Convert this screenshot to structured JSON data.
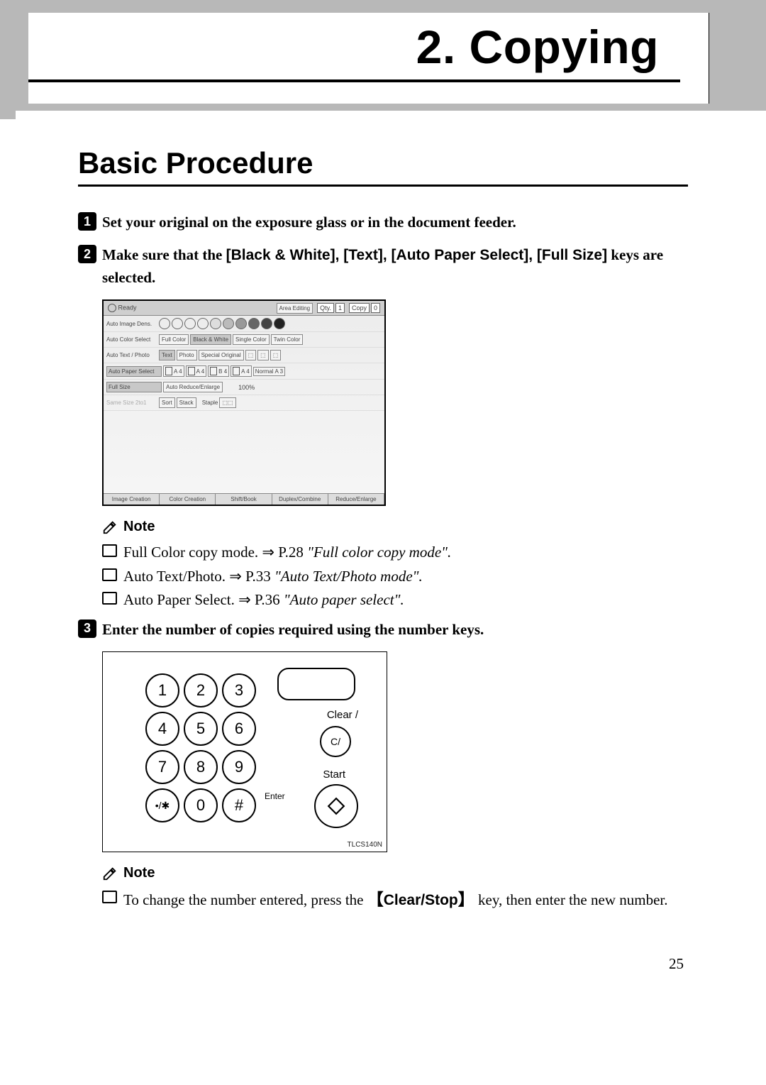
{
  "chapter": {
    "number": "2.",
    "title": "Copying"
  },
  "section": {
    "title": "Basic Procedure"
  },
  "steps": {
    "s1": {
      "num": "1",
      "text": "Set your original on the exposure glass or in the document feeder."
    },
    "s2": {
      "num": "2",
      "prefix": "Make sure that the ",
      "keys": "[Black & White], [Text], [Auto Paper Select], [Full Size]",
      "suffix": " keys are selected."
    },
    "s3": {
      "num": "3",
      "text": "Enter the number of copies required using the number keys."
    }
  },
  "panel": {
    "ready": "Ready",
    "area_editing": "Area Editing",
    "qty_label": "Qty.",
    "qty_value": "1",
    "copy_label": "Copy",
    "copy_value": "0",
    "rows": {
      "auto_image_dens": "Auto Image Dens.",
      "auto_color_select": "Auto Color Select",
      "full_color": "Full Color",
      "black_white": "Black & White",
      "single_color": "Single Color",
      "twin_color": "Twin Color",
      "auto_text_photo": "Auto Text / Photo",
      "text": "Text",
      "photo": "Photo",
      "special_original": "Special Original",
      "auto_paper_select": "Auto Paper Select",
      "a4": "A 4",
      "b4": "B 4",
      "a3": "A 3",
      "normal": "Normal",
      "full_size": "Full Size",
      "auto_reduce_enlarge": "Auto Reduce/Enlarge",
      "ratio": "100%",
      "same_size_2to1": "Same Size 2to1",
      "sort": "Sort",
      "stack": "Stack",
      "staple": "Staple"
    },
    "tabs": {
      "image_creation": "Image Creation",
      "color_creation": "Color Creation",
      "shift_book": "Shift/Book",
      "duplex_combine": "Duplex/Combine",
      "reduce_enlarge": "Reduce/Enlarge"
    }
  },
  "note1": {
    "label": "Note",
    "items": {
      "a_text": "Full Color copy mode. ",
      "a_arrow": "⇒",
      "a_page": " P.28 ",
      "a_ref": "\"Full color copy mode\".",
      "b_text": "Auto Text/Photo. ",
      "b_arrow": "⇒",
      "b_page": " P.33 ",
      "b_ref": "\"Auto Text/Photo mode\".",
      "c_text": "Auto Paper Select. ",
      "c_arrow": "⇒",
      "c_page": " P.36 ",
      "c_ref": "\"Auto paper select\"."
    }
  },
  "keypad": {
    "keys": {
      "k1": "1",
      "k2": "2",
      "k3": "3",
      "k4": "4",
      "k5": "5",
      "k6": "6",
      "k7": "7",
      "k8": "8",
      "k9": "9",
      "k_star": "•/✱",
      "k0": "0",
      "k_hash": "#"
    },
    "clear_label": "Clear /",
    "clear_key": "C/",
    "start_label": "Start",
    "enter_label": "Enter",
    "image_code": "TLCS140N"
  },
  "note2": {
    "label": "Note",
    "item": {
      "prefix": "To change the number entered, press the ",
      "key": "Clear/Stop",
      "suffix": " key, then enter the new number."
    }
  },
  "page_number": "25"
}
